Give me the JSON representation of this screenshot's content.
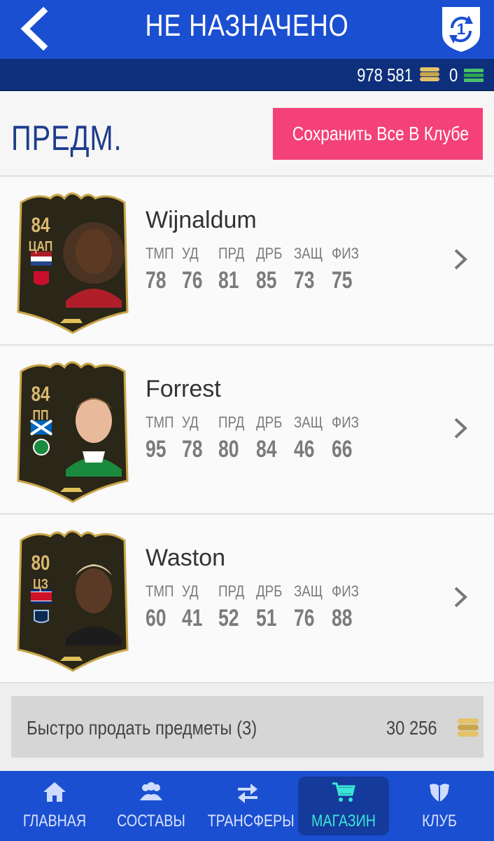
{
  "header": {
    "title": "НЕ НАЗНАЧЕНО",
    "sync_badge": "1"
  },
  "currency": {
    "coins": "978 581",
    "points": "0"
  },
  "section": {
    "title": "ПРЕДМ.",
    "save_all_label": "Сохранить Все В Клубе"
  },
  "stat_labels": [
    "ТМП",
    "УД",
    "ПРД",
    "ДРБ",
    "ЗАЩ",
    "ФИЗ"
  ],
  "players": [
    {
      "name": "Wijnaldum",
      "rating": "84",
      "position": "ЦАП",
      "stats": [
        "78",
        "76",
        "81",
        "85",
        "73",
        "75"
      ]
    },
    {
      "name": "Forrest",
      "rating": "84",
      "position": "ПП",
      "stats": [
        "95",
        "78",
        "80",
        "84",
        "46",
        "66"
      ]
    },
    {
      "name": "Waston",
      "rating": "80",
      "position": "ЦЗ",
      "stats": [
        "60",
        "41",
        "52",
        "51",
        "76",
        "88"
      ]
    }
  ],
  "quick_sell": {
    "label": "Быстро продать предметы (3)",
    "value": "30 256"
  },
  "nav": [
    {
      "label": "ГЛАВНАЯ",
      "icon": "home-icon"
    },
    {
      "label": "СОСТАВЫ",
      "icon": "squad-icon"
    },
    {
      "label": "ТРАНСФЕРЫ",
      "icon": "transfers-icon"
    },
    {
      "label": "МАГАЗИН",
      "icon": "cart-icon",
      "active": true
    },
    {
      "label": "КЛУБ",
      "icon": "club-icon"
    }
  ],
  "colors": {
    "primary": "#1b4fd1",
    "dark_bar": "#0e2f7c",
    "save_button": "#f4417a",
    "active_nav": "#39e6d2",
    "card_gold": "#d9b870"
  }
}
